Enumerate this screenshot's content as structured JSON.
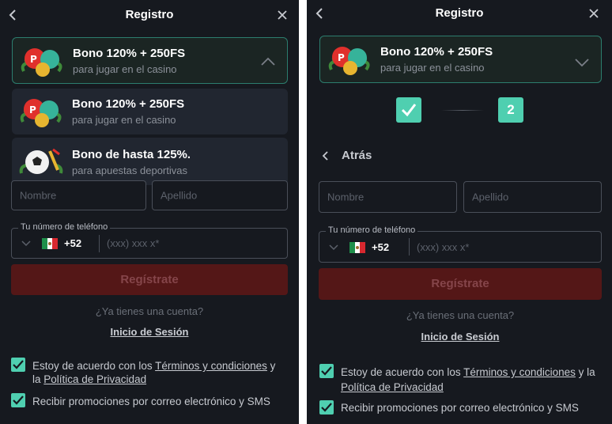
{
  "header": {
    "title": "Registro"
  },
  "bonus": {
    "casino": {
      "title": "Bono 120% + 250FS",
      "subtitle": "para jugar en el casino"
    },
    "sports": {
      "title": "Bono de hasta 125%.",
      "subtitle": "para apuestas deportivas"
    }
  },
  "stepper": {
    "step2_label": "2"
  },
  "back_label": "Atrás",
  "fields": {
    "first_name": "Nombre",
    "last_name": "Apellido"
  },
  "phone": {
    "label": "Tu número de teléfono",
    "code": "+52",
    "placeholder": "(xxx) xxx x*"
  },
  "register_button": "Regístrate",
  "have_account": "¿Ya tienes una cuenta?",
  "login_link": "Inicio de Sesión",
  "consent": {
    "terms_prefix": "Estoy de acuerdo con los ",
    "terms_link": "Términos y condiciones",
    "terms_mid": " y la ",
    "privacy_link": "Política de Privacidad",
    "promos": "Recibir promociones por correo electrónico y SMS"
  },
  "colors": {
    "accent": "#4fcfb0",
    "register_bg": "#541717",
    "panel_bg": "#16191f"
  }
}
